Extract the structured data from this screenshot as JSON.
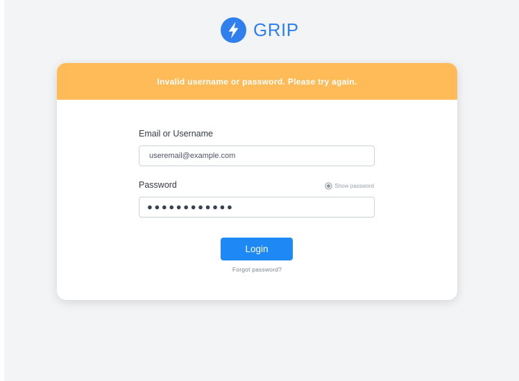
{
  "brand": {
    "name": "GRIP",
    "logo_icon": "lightning-bolt-icon",
    "color": "#2f80ed"
  },
  "alert": {
    "message": "Invalid username or password. Please try again.",
    "color": "#ffbb57"
  },
  "form": {
    "email_label": "Email or Username",
    "email_value": "useremail@example.com",
    "password_label": "Password",
    "show_password_label": "Show password",
    "show_password_icon": "radio-icon",
    "password_masked": "●●●●●●●●●●●●",
    "login_label": "Login",
    "login_color": "#1e88f5",
    "forgot_password_label": "Forgot password?"
  }
}
